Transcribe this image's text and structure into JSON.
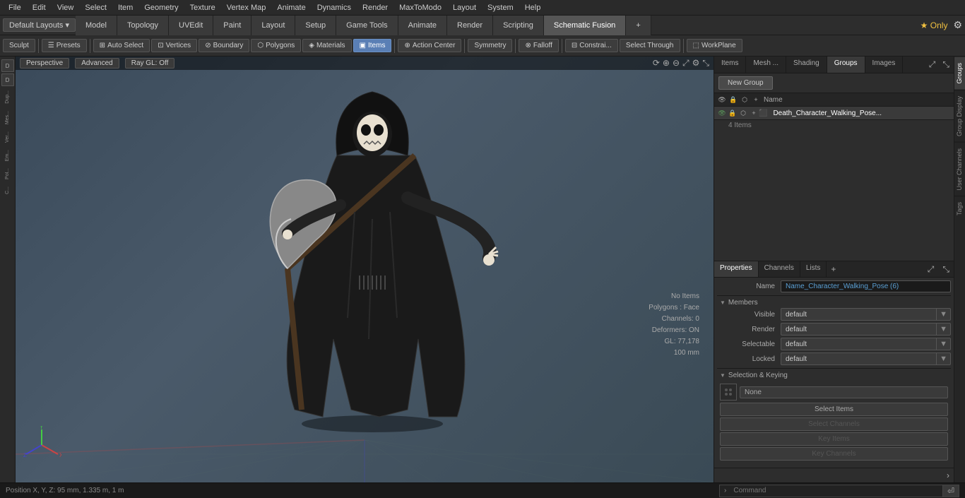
{
  "menubar": {
    "items": [
      "File",
      "Edit",
      "View",
      "Select",
      "Item",
      "Geometry",
      "Texture",
      "Vertex Map",
      "Animate",
      "Dynamics",
      "Render",
      "MaxToModo",
      "Layout",
      "System",
      "Help"
    ]
  },
  "layout_bar": {
    "dropdown": "Default Layouts ▾",
    "tabs": [
      "Model",
      "Topology",
      "UVEdit",
      "Paint",
      "Layout",
      "Setup",
      "Game Tools",
      "Animate",
      "Render",
      "Scripting",
      "Schematic Fusion"
    ],
    "active_tab": "Schematic Fusion",
    "plus": "+",
    "star_label": "★ Only",
    "gear": "⚙"
  },
  "toolbar": {
    "sculpt": "Sculpt",
    "presets": "Presets",
    "auto_select": "Auto Select",
    "vertices": "Vertices",
    "boundary": "Boundary",
    "polygons": "Polygons",
    "materials": "Materials",
    "items": "Items",
    "action_center": "Action Center",
    "symmetry": "Symmetry",
    "falloff": "Falloff",
    "constrai": "Constrai...",
    "select_through": "Select Through",
    "workplane": "WorkPlane"
  },
  "viewport": {
    "perspective": "Perspective",
    "advanced": "Advanced",
    "ray_gl": "Ray GL: Off"
  },
  "right_panel": {
    "tabs": [
      "Items",
      "Mesh ...",
      "Shading",
      "Groups",
      "Images"
    ],
    "active_tab": "Groups",
    "new_group_btn": "New Group",
    "col_name": "Name",
    "group": {
      "name": "Death_Character_Walking_Pose...",
      "count": "4 Items"
    }
  },
  "properties": {
    "tabs": [
      "Properties",
      "Channels",
      "Lists"
    ],
    "active_tab": "Properties",
    "name_label": "Name",
    "name_value": "Name_Character_Walking_Pose (6)",
    "sections": {
      "members": "Members",
      "selection_keying": "Selection & Keying"
    },
    "fields": {
      "visible": {
        "label": "Visible",
        "value": "default"
      },
      "render": {
        "label": "Render",
        "value": "default"
      },
      "selectable": {
        "label": "Selectable",
        "value": "default"
      },
      "locked": {
        "label": "Locked",
        "value": "default"
      }
    },
    "sel_keying": {
      "none_label": "None",
      "select_items_btn": "Select Items",
      "select_channels_btn": "Select Channels",
      "key_items_btn": "Key Items",
      "key_channels_btn": "Key Channels"
    }
  },
  "vert_tabs": [
    "Groups",
    "Group Display",
    "User Channels",
    "Tags"
  ],
  "status_bar": {
    "position": "Position X, Y, Z:  95 mm, 1.335 m, 1 m",
    "command_placeholder": "Command"
  },
  "viewport_info": {
    "no_items": "No Items",
    "polygons": "Polygons : Face",
    "channels": "Channels: 0",
    "deformers": "Deformers: ON",
    "gl": "GL: 77,178",
    "poly_count": "100 mm"
  }
}
